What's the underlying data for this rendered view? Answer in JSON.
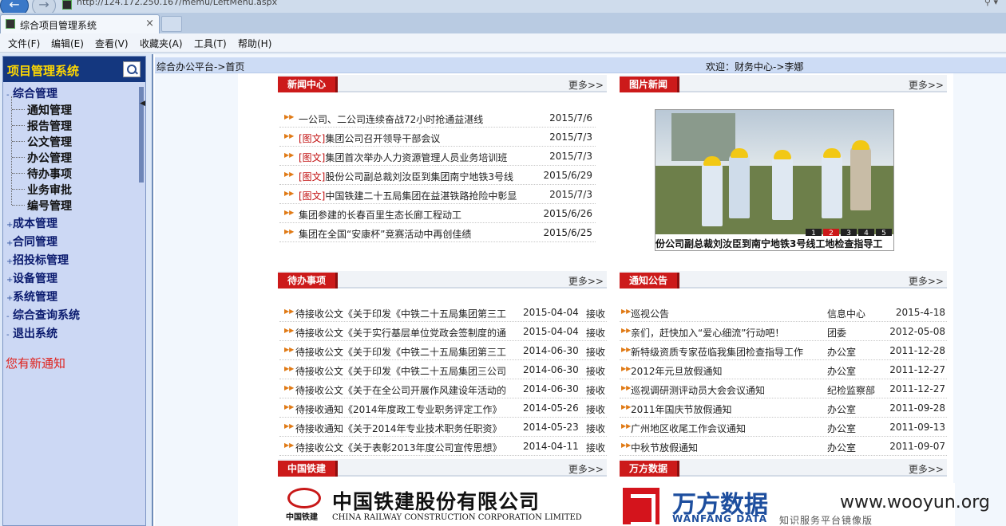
{
  "browser": {
    "url": "http://124.172.250.167/memu/LeftMenu.aspx",
    "tab_title": "综合项目管理系统",
    "tab_close": "×",
    "menu": [
      "文件(F)",
      "编辑(E)",
      "查看(V)",
      "收藏夹(A)",
      "工具(T)",
      "帮助(H)"
    ]
  },
  "sidebar": {
    "title": "项目管理系统",
    "sections": [
      {
        "label": "综合管理",
        "toggle": "-",
        "children": [
          "通知管理",
          "报告管理",
          "公文管理",
          "办公管理",
          "待办事项",
          "业务审批",
          "编号管理"
        ]
      },
      {
        "label": "成本管理",
        "toggle": "+"
      },
      {
        "label": "合同管理",
        "toggle": "+"
      },
      {
        "label": "招投标管理",
        "toggle": "+"
      },
      {
        "label": "设备管理",
        "toggle": "+"
      },
      {
        "label": "系统管理",
        "toggle": "+"
      },
      {
        "label": "综合查询系统",
        "toggle": "-"
      },
      {
        "label": "退出系统",
        "toggle": "-"
      }
    ],
    "notice": "您有新通知"
  },
  "main": {
    "breadcrumb": "综合办公平台->首页",
    "welcome": "欢迎：财务中心->李娜"
  },
  "more_label": "更多>>",
  "news": {
    "title": "新闻中心",
    "items": [
      {
        "tag": "",
        "text": "一公司、二公司连续奋战72小时抢通益湛线",
        "date": "2015/7/6"
      },
      {
        "tag": "[图文]",
        "text": "集团公司召开领导干部会议",
        "date": "2015/7/3"
      },
      {
        "tag": "[图文]",
        "text": "集团首次举办人力资源管理人员业务培训班",
        "date": "2015/7/3"
      },
      {
        "tag": "[图文]",
        "text": "股份公司副总裁刘汝臣到集团南宁地铁3号线",
        "date": "2015/6/29"
      },
      {
        "tag": "[图文]",
        "text": "中国铁建二十五局集团在益湛铁路抢险中彰显",
        "date": "2015/7/3"
      },
      {
        "tag": "",
        "text": "集团参建的长春百里生态长廊工程动工",
        "date": "2015/6/26"
      },
      {
        "tag": "",
        "text": "集团在全国“安康杯”竞赛活动中再创佳绩",
        "date": "2015/6/25"
      }
    ]
  },
  "photo_news": {
    "title": "图片新闻",
    "caption": "份公司副总裁刘汝臣到南宁地铁3号线工地检查指导工",
    "pages": [
      "1",
      "2",
      "3",
      "4",
      "5"
    ],
    "active_page": 2
  },
  "todo": {
    "title": "待办事项",
    "items": [
      {
        "text": "待接收公文《关于印发《中铁二十五局集团第三工",
        "date": "2015-04-04",
        "action": "接收"
      },
      {
        "text": "待接收公文《关于实行基层单位党政会签制度的通",
        "date": "2015-04-04",
        "action": "接收"
      },
      {
        "text": "待接收公文《关于印发《中铁二十五局集团第三工",
        "date": "2014-06-30",
        "action": "接收"
      },
      {
        "text": "待接收公文《关于印发《中铁二十五局集团三公司",
        "date": "2014-06-30",
        "action": "接收"
      },
      {
        "text": "待接收公文《关于在全公司开展作风建设年活动的",
        "date": "2014-06-30",
        "action": "接收"
      },
      {
        "text": "待接收通知《2014年度政工专业职务评定工作》",
        "date": "2014-05-26",
        "action": "接收"
      },
      {
        "text": "待接收通知《关于2014年专业技术职务任职资》",
        "date": "2014-05-23",
        "action": "接收"
      },
      {
        "text": "待接收公文《关于表彰2013年度公司宣传思想》",
        "date": "2014-04-11",
        "action": "接收"
      }
    ]
  },
  "notices": {
    "title": "通知公告",
    "items": [
      {
        "text": "巡视公告",
        "dept": "信息中心",
        "date": "2015-4-18"
      },
      {
        "text": "亲们，赶快加入“爱心细流”行动吧！",
        "dept": "团委",
        "date": "2012-05-08"
      },
      {
        "text": "新特级资质专家莅临我集团检查指导工作",
        "dept": "办公室",
        "date": "2011-12-28"
      },
      {
        "text": "2012年元旦放假通知",
        "dept": "办公室",
        "date": "2011-12-27"
      },
      {
        "text": "巡视调研测评动员大会会议通知",
        "dept": "纪检监察部",
        "date": "2011-12-27"
      },
      {
        "text": "2011年国庆节放假通知",
        "dept": "办公室",
        "date": "2011-09-28"
      },
      {
        "text": "广州地区收尾工作会议通知",
        "dept": "办公室",
        "date": "2011-09-13"
      },
      {
        "text": "中秋节放假通知",
        "dept": "办公室",
        "date": "2011-09-07"
      }
    ]
  },
  "crcc": {
    "title": "中国铁建",
    "name_cn": "中国铁建股份有限公司",
    "name_en": "CHINA RAILWAY CONSTRUCTION CORPORATION LIMITED",
    "logo_text": "中国铁建"
  },
  "wanfang": {
    "title": "万方数据",
    "name_cn": "万方数据",
    "name_en": "WANFANG DATA",
    "slogan": "知识服务平台镜像版"
  },
  "watermark": "www.wooyun.org"
}
